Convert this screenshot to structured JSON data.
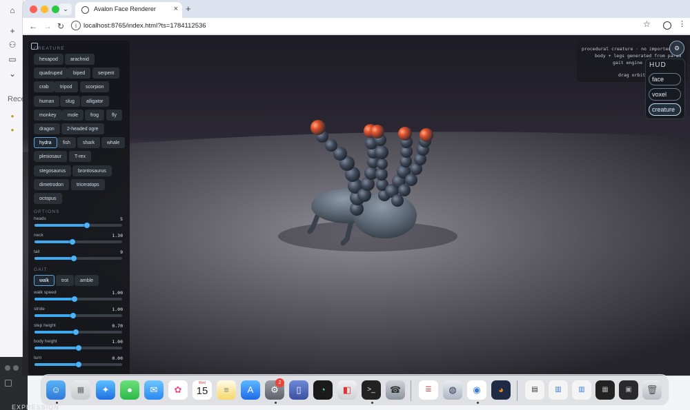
{
  "background_app": {
    "recent_label": "Rece",
    "expression_label": "EXPRESSION"
  },
  "browser": {
    "tab_title": "Avalon Face Renderer",
    "url": "localhost:8765/index.html?ts=1784112536"
  },
  "panel": {
    "creature_label": "CREATURE",
    "creatures": [
      {
        "label": "hexapod",
        "selected": false
      },
      {
        "label": "arachnid",
        "selected": false
      },
      {
        "label": "quadruped",
        "selected": false
      },
      {
        "label": "biped",
        "selected": false
      },
      {
        "label": "serpent",
        "selected": false
      },
      {
        "label": "crab",
        "selected": false
      },
      {
        "label": "tripod",
        "selected": false
      },
      {
        "label": "scorpion",
        "selected": false
      },
      {
        "label": "human",
        "selected": false
      },
      {
        "label": "slug",
        "selected": false
      },
      {
        "label": "alligator",
        "selected": false
      },
      {
        "label": "monkey",
        "selected": false
      },
      {
        "label": "mole",
        "selected": false
      },
      {
        "label": "frog",
        "selected": false
      },
      {
        "label": "fly",
        "selected": false
      },
      {
        "label": "dragon",
        "selected": false
      },
      {
        "label": "2-headed ogre",
        "selected": false
      },
      {
        "label": "hydra",
        "selected": true
      },
      {
        "label": "fish",
        "selected": false
      },
      {
        "label": "shark",
        "selected": false
      },
      {
        "label": "whale",
        "selected": false
      },
      {
        "label": "plesiosaur",
        "selected": false
      },
      {
        "label": "T-rex",
        "selected": false
      },
      {
        "label": "stegosaurus",
        "selected": false
      },
      {
        "label": "brontosaurus",
        "selected": false
      },
      {
        "label": "dimetrodon",
        "selected": false
      },
      {
        "label": "triceratops",
        "selected": false
      },
      {
        "label": "octopus",
        "selected": false
      }
    ],
    "options_label": "OPTIONS",
    "options": [
      {
        "label": "heads",
        "value": "5",
        "fraction": 0.6
      },
      {
        "label": "neck",
        "value": "1.30",
        "fraction": 0.43
      },
      {
        "label": "tail",
        "value": "9",
        "fraction": 0.45
      }
    ],
    "gait_label": "GAIT",
    "gaits": [
      {
        "label": "walk",
        "selected": true
      },
      {
        "label": "trot",
        "selected": false
      },
      {
        "label": "amble",
        "selected": false
      }
    ],
    "gait_sliders": [
      {
        "label": "walk speed",
        "value": "1.00",
        "fraction": 0.46
      },
      {
        "label": "stride",
        "value": "1.00",
        "fraction": 0.44
      },
      {
        "label": "step height",
        "value": "0.70",
        "fraction": 0.47
      },
      {
        "label": "body height",
        "value": "1.00",
        "fraction": 0.5
      },
      {
        "label": "turn",
        "value": "0.00",
        "fraction": 0.5
      }
    ]
  },
  "info": {
    "line1": "procedural creature · no imported",
    "line2": "body + legs generated from param",
    "line3": "gait engine c",
    "line4": "drag orbit"
  },
  "hud": {
    "title": "HUD",
    "buttons": [
      {
        "label": "face",
        "selected": false
      },
      {
        "label": "voxel",
        "selected": false
      },
      {
        "label": "creature",
        "selected": true
      }
    ]
  },
  "dock": {
    "calendar_day": "Wed",
    "calendar_date": "15",
    "settings_badge": "2"
  },
  "colors": {
    "accent": "#3fa9f0",
    "panel_bg": "#14161a",
    "head_glow": "#ff6a3d"
  }
}
